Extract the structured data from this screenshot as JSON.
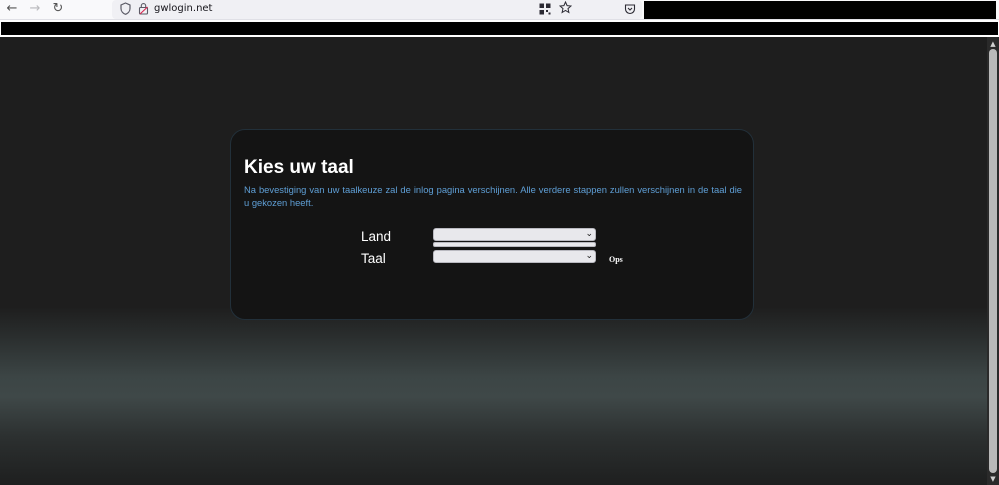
{
  "browser": {
    "url": "gwlogin.net",
    "back_icon": "←",
    "forward_icon": "→",
    "reload_icon": "↻"
  },
  "panel": {
    "title": "Kies uw taal",
    "description": "Na bevestiging van uw taalkeuze zal de inlog pagina verschijnen. Alle verdere stappen zullen verschijnen in de taal die u gekozen heeft.",
    "land_label": "Land",
    "taal_label": "Taal",
    "land_value": "",
    "taal_value": "",
    "ops_label": "Ops"
  },
  "colors": {
    "panel_bg": "#141414",
    "accent_text": "#5f9fd6",
    "page_bg": "#1e1e1e"
  },
  "icons": {
    "chevron": "⌄",
    "scroll_up": "▲",
    "scroll_down": "▼"
  }
}
